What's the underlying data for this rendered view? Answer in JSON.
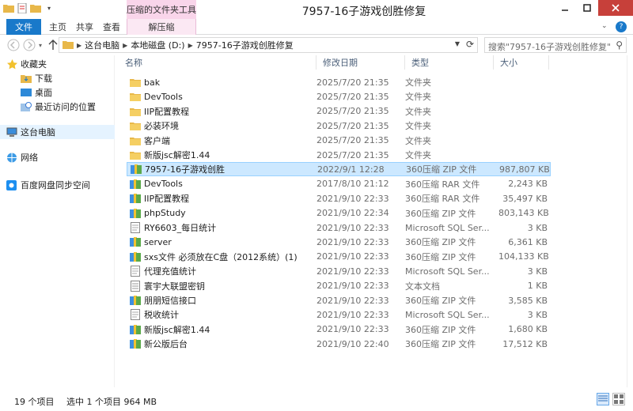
{
  "titlebar": {
    "title": "7957-16子游戏创胜修复",
    "context_group": "压缩的文件夹工具"
  },
  "ribbon": {
    "tabs": [
      {
        "label": "文件"
      },
      {
        "label": "主页"
      },
      {
        "label": "共享"
      },
      {
        "label": "查看"
      },
      {
        "label": "解压缩"
      }
    ]
  },
  "address": {
    "segments": [
      "这台电脑",
      "本地磁盘 (D:)",
      "7957-16子游戏创胜修复"
    ],
    "search_placeholder": "搜索\"7957-16子游戏创胜修复\""
  },
  "sidebar": {
    "items": [
      {
        "label": "收藏夹",
        "icon": "star-icon"
      },
      {
        "label": "下载",
        "icon": "download-folder-icon"
      },
      {
        "label": "桌面",
        "icon": "desktop-icon"
      },
      {
        "label": "最近访问的位置",
        "icon": "recent-places-icon"
      },
      {
        "label": "这台电脑",
        "icon": "computer-icon"
      },
      {
        "label": "网络",
        "icon": "network-icon"
      },
      {
        "label": "百度网盘同步空间",
        "icon": "baidu-netdisk-icon"
      }
    ]
  },
  "columns": {
    "name": "名称",
    "date": "修改日期",
    "type": "类型",
    "size": "大小"
  },
  "files": [
    {
      "name": "bak",
      "date": "2025/7/20 21:35",
      "type": "文件夹",
      "size": "",
      "icon": "folder"
    },
    {
      "name": "DevTools",
      "date": "2025/7/20 21:35",
      "type": "文件夹",
      "size": "",
      "icon": "folder"
    },
    {
      "name": "IIP配置教程",
      "date": "2025/7/20 21:35",
      "type": "文件夹",
      "size": "",
      "icon": "folder"
    },
    {
      "name": "必装环境",
      "date": "2025/7/20 21:35",
      "type": "文件夹",
      "size": "",
      "icon": "folder"
    },
    {
      "name": "客户端",
      "date": "2025/7/20 21:35",
      "type": "文件夹",
      "size": "",
      "icon": "folder"
    },
    {
      "name": "新版jsc解密1.44",
      "date": "2025/7/20 21:35",
      "type": "文件夹",
      "size": "",
      "icon": "folder"
    },
    {
      "name": "7957-16子游戏创胜",
      "date": "2022/9/1 12:28",
      "type": "360压缩 ZIP 文件",
      "size": "987,807 KB",
      "icon": "zip",
      "selected": true
    },
    {
      "name": "DevTools",
      "date": "2017/8/10 21:12",
      "type": "360压缩 RAR 文件",
      "size": "2,243 KB",
      "icon": "zip"
    },
    {
      "name": "IIP配置教程",
      "date": "2021/9/10 22:33",
      "type": "360压缩 RAR 文件",
      "size": "35,497 KB",
      "icon": "zip"
    },
    {
      "name": "phpStudy",
      "date": "2021/9/10 22:34",
      "type": "360压缩 ZIP 文件",
      "size": "803,143 KB",
      "icon": "zip"
    },
    {
      "name": "RY6603_每日统计",
      "date": "2021/9/10 22:33",
      "type": "Microsoft SQL Ser...",
      "size": "3 KB",
      "icon": "sql"
    },
    {
      "name": "server",
      "date": "2021/9/10 22:33",
      "type": "360压缩 ZIP 文件",
      "size": "6,361 KB",
      "icon": "zip"
    },
    {
      "name": "sxs文件 必须放在C盘（2012系统）(1)",
      "date": "2021/9/10 22:33",
      "type": "360压缩 ZIP 文件",
      "size": "104,133 KB",
      "icon": "zip"
    },
    {
      "name": "代理充值统计",
      "date": "2021/9/10 22:33",
      "type": "Microsoft SQL Ser...",
      "size": "3 KB",
      "icon": "sql"
    },
    {
      "name": "寰宇大联盟密钥",
      "date": "2021/9/10 22:33",
      "type": "文本文档",
      "size": "1 KB",
      "icon": "txt"
    },
    {
      "name": "朋朋短信接口",
      "date": "2021/9/10 22:33",
      "type": "360压缩 ZIP 文件",
      "size": "3,585 KB",
      "icon": "zip"
    },
    {
      "name": "税收统计",
      "date": "2021/9/10 22:33",
      "type": "Microsoft SQL Ser...",
      "size": "3 KB",
      "icon": "sql"
    },
    {
      "name": "新版jsc解密1.44",
      "date": "2021/9/10 22:33",
      "type": "360压缩 ZIP 文件",
      "size": "1,680 KB",
      "icon": "zip"
    },
    {
      "name": "新公版后台",
      "date": "2021/9/10 22:40",
      "type": "360压缩 ZIP 文件",
      "size": "17,512 KB",
      "icon": "zip"
    }
  ],
  "status": {
    "count": "19 个项目",
    "selection": "选中 1 个项目  964 MB"
  },
  "colors": {
    "accent": "#1979ca",
    "selection": "#cce8ff",
    "context": "#f9d5ea"
  }
}
